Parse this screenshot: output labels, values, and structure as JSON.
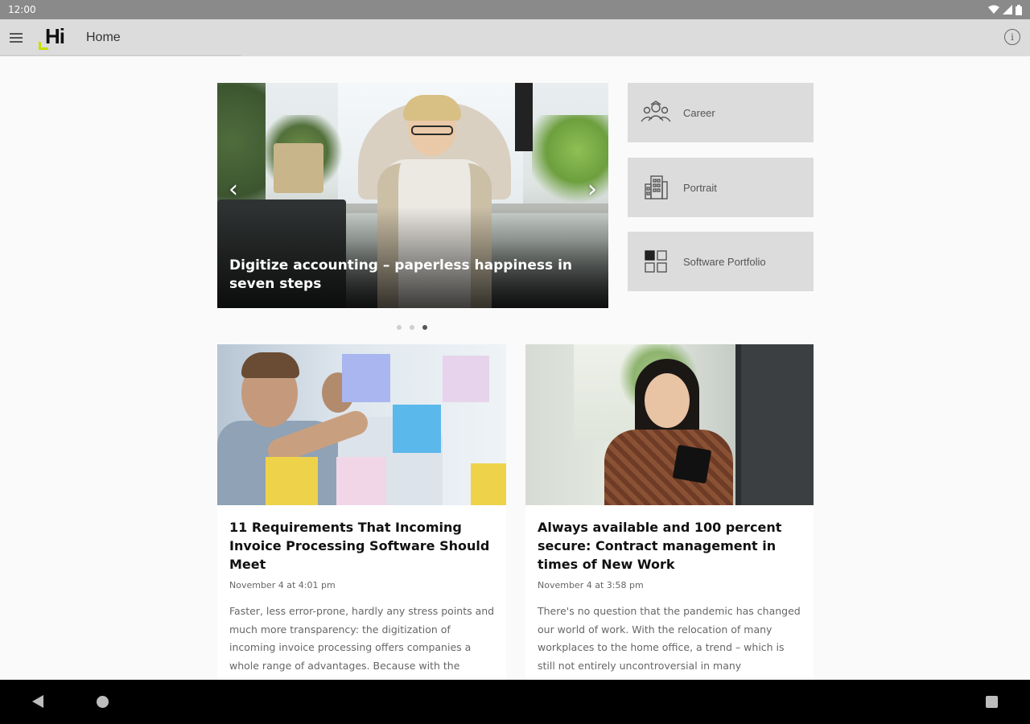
{
  "status_bar": {
    "time": "12:00",
    "icons": [
      "wifi-icon",
      "signal-icon",
      "battery-icon"
    ]
  },
  "app_bar": {
    "logo_text": "Hi",
    "title": "Home",
    "menu_icon": "menu-icon",
    "info_icon": "info-icon"
  },
  "hero": {
    "title": "Digitize accounting – paperless happiness in seven steps",
    "prev_icon": "chevron-left-icon",
    "next_icon": "chevron-right-icon",
    "slides_total": 3,
    "active_slide": 3
  },
  "quick_links": [
    {
      "label": "Career",
      "icon": "career-icon"
    },
    {
      "label": "Portrait",
      "icon": "building-icon"
    },
    {
      "label": "Software Portfolio",
      "icon": "grid-icon"
    }
  ],
  "articles": [
    {
      "title": "11 Requirements That Incoming Invoice Processing Software Should Meet",
      "date": "November 4 at 4:01 pm",
      "excerpt": "Faster, less error-prone, hardly any stress points and much more transparency: the digitization of incoming invoice processing offers companies a whole range of advantages. Because with the"
    },
    {
      "title": "Always available and 100 percent secure: Contract management in times of New Work",
      "date": "November 4 at 3:58 pm",
      "excerpt": "There's no question that the pandemic has changed our world of work. With the relocation of many workplaces to the home office, a trend – which is still not entirely uncontroversial in many"
    }
  ],
  "colors": {
    "app_bar": "#dcdcdc",
    "status_bar": "#8a8a8a",
    "logo_accent": "#c6e000",
    "tile": "#dcdcdc",
    "nav_bar": "#000000"
  }
}
